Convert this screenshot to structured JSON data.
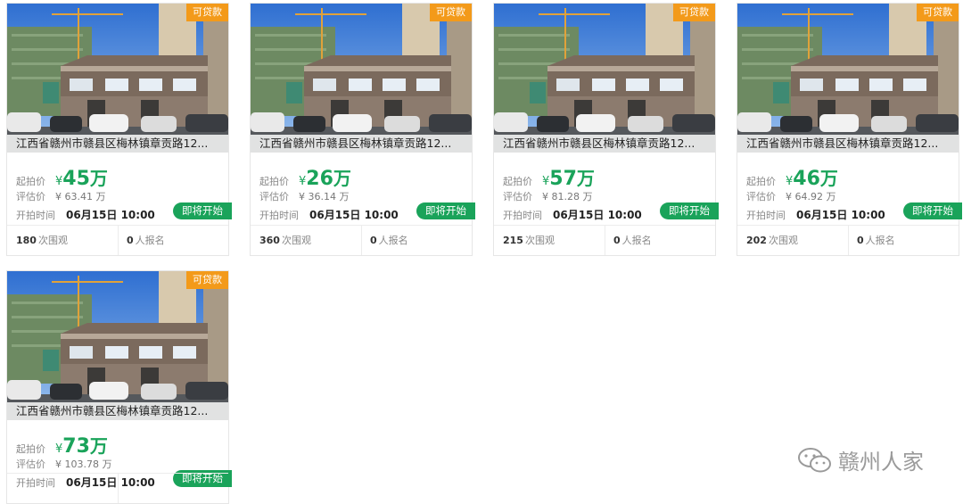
{
  "cards": [
    {
      "badge": "可贷款",
      "title": "江西省赣州市赣县区梅林镇章贡路12...",
      "start_label": "起拍价",
      "start_yen": "¥",
      "start_value": "45",
      "start_unit": "万",
      "eval_label": "评估价",
      "eval_value": "¥ 63.41 万",
      "time_label": "开拍时间",
      "time_value": "06月15日 10:00",
      "status": "即将开始",
      "views": "180",
      "views_label": "次围观",
      "signups": "0",
      "signups_label": "人报名"
    },
    {
      "badge": "可贷款",
      "title": "江西省赣州市赣县区梅林镇章贡路12...",
      "start_label": "起拍价",
      "start_yen": "¥",
      "start_value": "26",
      "start_unit": "万",
      "eval_label": "评估价",
      "eval_value": "¥ 36.14 万",
      "time_label": "开拍时间",
      "time_value": "06月15日 10:00",
      "status": "即将开始",
      "views": "360",
      "views_label": "次围观",
      "signups": "0",
      "signups_label": "人报名"
    },
    {
      "badge": "可贷款",
      "title": "江西省赣州市赣县区梅林镇章贡路12...",
      "start_label": "起拍价",
      "start_yen": "¥",
      "start_value": "57",
      "start_unit": "万",
      "eval_label": "评估价",
      "eval_value": "¥ 81.28 万",
      "time_label": "开拍时间",
      "time_value": "06月15日 10:00",
      "status": "即将开始",
      "views": "215",
      "views_label": "次围观",
      "signups": "0",
      "signups_label": "人报名"
    },
    {
      "badge": "可贷款",
      "title": "江西省赣州市赣县区梅林镇章贡路12...",
      "start_label": "起拍价",
      "start_yen": "¥",
      "start_value": "46",
      "start_unit": "万",
      "eval_label": "评估价",
      "eval_value": "¥ 64.92 万",
      "time_label": "开拍时间",
      "time_value": "06月15日 10:00",
      "status": "即将开始",
      "views": "202",
      "views_label": "次围观",
      "signups": "0",
      "signups_label": "人报名"
    },
    {
      "badge": "可贷款",
      "title": "江西省赣州市赣县区梅林镇章贡路12...",
      "start_label": "起拍价",
      "start_yen": "¥",
      "start_value": "73",
      "start_unit": "万",
      "eval_label": "评估价",
      "eval_value": "¥ 103.78 万",
      "time_label": "开拍时间",
      "time_value": "06月15日 10:00",
      "status": "即将开始",
      "views": "",
      "views_label": "",
      "signups": "",
      "signups_label": ""
    }
  ],
  "watermark": {
    "text": "赣州人家",
    "icon": "wechat-icon"
  },
  "colors": {
    "accent_green": "#1aa35a",
    "badge_orange": "#f39a1a"
  }
}
